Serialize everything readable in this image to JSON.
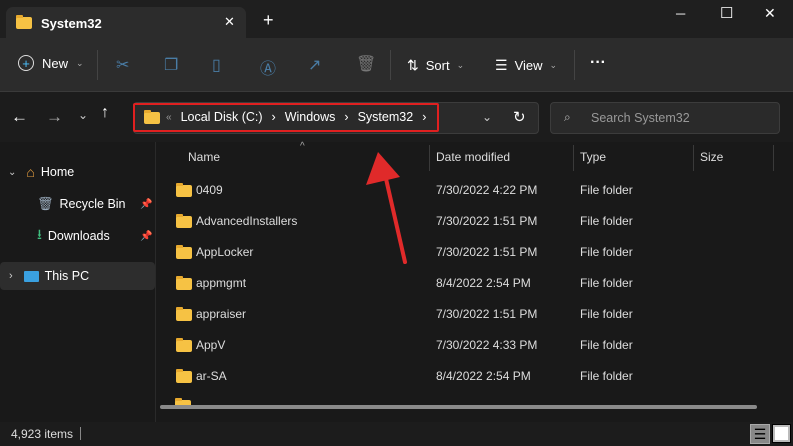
{
  "window": {
    "tab_title": "System32",
    "new_tab": "+",
    "minimize": "─",
    "maximize": "☐",
    "close": "✕"
  },
  "toolbar": {
    "new_label": "New",
    "sort_label": "Sort",
    "view_label": "View",
    "more": "···"
  },
  "address": {
    "crumbs": [
      "Local Disk (C:)",
      "Windows",
      "System32"
    ],
    "overflow": "«",
    "search_placeholder": "Search System32"
  },
  "sidebar": {
    "items": [
      {
        "label": "Home"
      },
      {
        "label": "Recycle Bin"
      },
      {
        "label": "Downloads"
      },
      {
        "label": "This PC"
      }
    ]
  },
  "columns": [
    "Name",
    "Date modified",
    "Type",
    "Size"
  ],
  "rows": [
    {
      "name": "0409",
      "date": "7/30/2022 4:22 PM",
      "type": "File folder"
    },
    {
      "name": "AdvancedInstallers",
      "date": "7/30/2022 1:51 PM",
      "type": "File folder"
    },
    {
      "name": "AppLocker",
      "date": "7/30/2022 1:51 PM",
      "type": "File folder"
    },
    {
      "name": "appmgmt",
      "date": "8/4/2022 2:54 PM",
      "type": "File folder"
    },
    {
      "name": "appraiser",
      "date": "7/30/2022 1:51 PM",
      "type": "File folder"
    },
    {
      "name": "AppV",
      "date": "7/30/2022 4:33 PM",
      "type": "File folder"
    },
    {
      "name": "ar-SA",
      "date": "8/4/2022 2:54 PM",
      "type": "File folder"
    }
  ],
  "status": {
    "count": "4,923 items"
  },
  "colors": {
    "highlight": "#e02020",
    "folder": "#f6c244"
  }
}
